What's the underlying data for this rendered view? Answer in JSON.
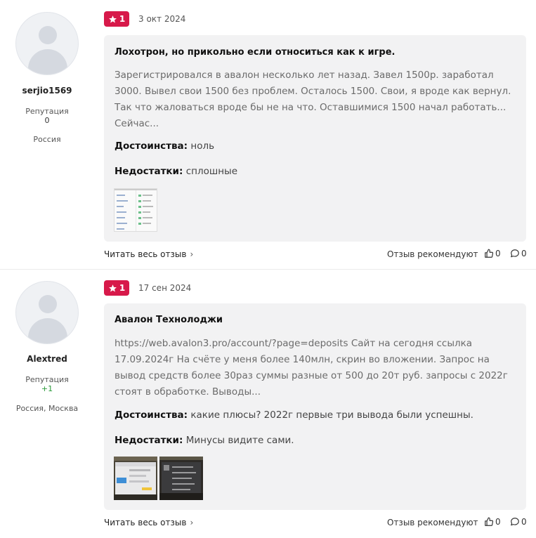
{
  "reviews": [
    {
      "author": "serjio1569",
      "reputation_label": "Репутация",
      "reputation_value": "0",
      "location": "Россия",
      "rating": "1",
      "date": "3 окт 2024",
      "title": "Лохотрон, но прикольно если относиться как к игре.",
      "text_lines": [
        "Зарегистрировался в авалон несколько лет назад. Завел 1500р. заработал",
        "3000. Вывел свои 1500 без проблем. Осталось 1500. Свои, я вроде как вернул.",
        "Так что жаловаться вроде бы не на что. Оставшимися 1500 начал работать...",
        "Сейчас..."
      ],
      "pros_label": "Достоинства:",
      "pros": "ноль",
      "cons_label": "Недостатки:",
      "cons": "сплошные",
      "read_more": "Читать весь отзыв",
      "recommend_label": "Отзыв рекомендуют",
      "likes": "0",
      "comments": "0"
    },
    {
      "author": "Alextred",
      "reputation_label": "Репутация",
      "reputation_value": "+1",
      "location": "Россия, Москва",
      "rating": "1",
      "date": "17 сен 2024",
      "title": "Авалон Технолоджи",
      "text_lines": [
        "https://web.avalon3.pro/account/?page=deposits Сайт на сегодня ссылка",
        "17.09.2024г На счёте у меня более 140млн, скрин во вложении. Запрос на",
        "вывод средств более 30раз суммы разные от 500 до 20т руб. запросы с 2022г",
        "стоят в обработке. Выводы..."
      ],
      "pros_label": "Достоинства:",
      "pros": "какие плюсы? 2022г первые три вывода были успешны.",
      "cons_label": "Недостатки:",
      "cons": "Минусы видите сами.",
      "read_more": "Читать весь отзыв",
      "recommend_label": "Отзыв рекомендуют",
      "likes": "0",
      "comments": "0"
    }
  ],
  "colors": {
    "badge": "#d7194a",
    "card": "#f2f2f3",
    "positive": "#2a9a3a"
  }
}
